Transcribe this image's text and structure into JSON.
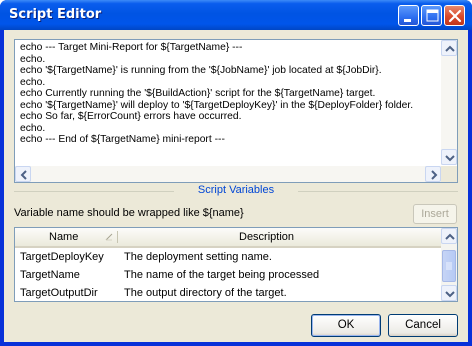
{
  "window": {
    "title": "Script Editor"
  },
  "titlebar_buttons": {
    "minimize_icon": "minimize-icon",
    "maximize_icon": "maximize-icon",
    "close_icon": "close-icon"
  },
  "script": {
    "lines": [
      "echo --- Target Mini-Report for ${TargetName} ---",
      "echo.",
      "echo '${TargetName}' is running from the '${JobName}' job located at ${JobDir}.",
      "echo.",
      "echo Currently running the '${BuildAction}' script for the ${TargetName} target.",
      "echo '${TargetName}' will deploy to '${TargetDeployKey}' in the ${DeployFolder} folder.",
      "echo So far, ${ErrorCount} errors have occurred.",
      "echo.",
      "echo --- End of ${TargetName} mini-report ---"
    ]
  },
  "variables": {
    "section_title": "Script Variables",
    "hint": "Variable name should be wrapped like ${name}",
    "insert_label": "Insert",
    "columns": {
      "name": "Name",
      "description": "Description"
    },
    "rows": [
      {
        "name": "TargetDeployKey",
        "description": "The deployment setting name."
      },
      {
        "name": "TargetName",
        "description": "The name of the target being processed"
      },
      {
        "name": "TargetOutputDir",
        "description": "The output directory of the target."
      }
    ]
  },
  "footer": {
    "ok_label": "OK",
    "cancel_label": "Cancel"
  },
  "colors": {
    "titlebar": "#0054e3",
    "section_title": "#0046d5",
    "client_bg": "#ece9d8"
  }
}
